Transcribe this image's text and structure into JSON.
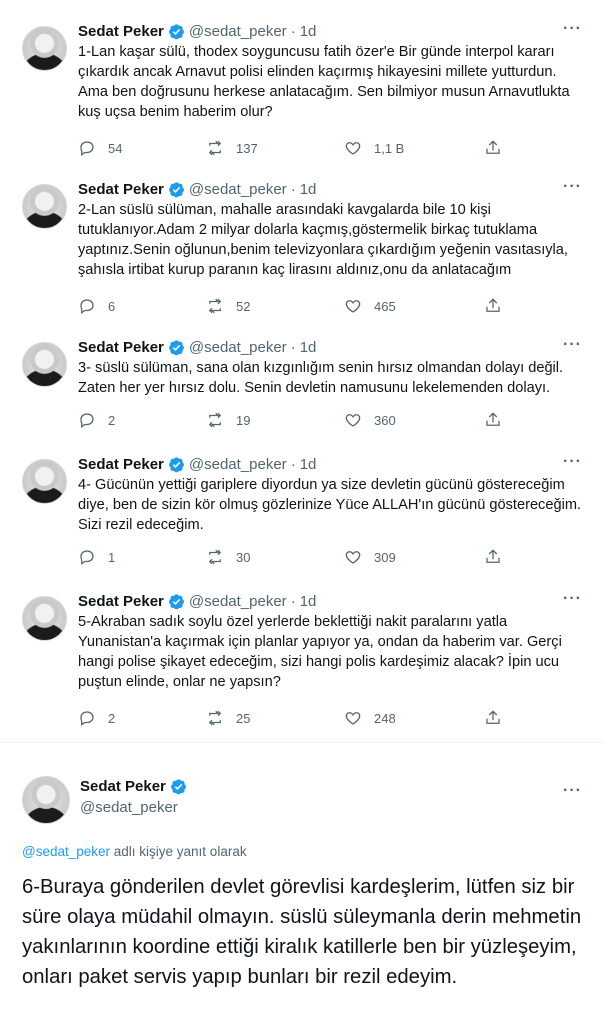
{
  "author": {
    "name": "Sedat Peker",
    "handle": "@sedat_peker",
    "time": "1d"
  },
  "colors": {
    "accent": "#1d9bf0",
    "muted": "#536471",
    "text": "#0f1419"
  },
  "tweets": [
    {
      "text": "1-Lan kaşar sülü, thodex soyguncusu fatih özer'e Bir günde interpol kararı çıkardık ancak Arnavut polisi elinden kaçırmış hikayesini millete yutturdun. Ama ben doğrusunu herkese anlatacağım. Sen bilmiyor musun Arnavutlukta kuş uçsa benim haberim olur?",
      "replies": "54",
      "retweets": "137",
      "likes": "1,1 B"
    },
    {
      "text": "2-Lan süslü sülüman, mahalle arasındaki kavgalarda bile 10 kişi tutuklanıyor.Adam 2 milyar dolarla kaçmış,göstermelik birkaç tutuklama yaptınız.Senin oğlunun,benim televizyonlara çıkardığım yeğenin vasıtasıyla, şahısla irtibat kurup paranın kaç lirasını aldınız,onu da anlatacağım",
      "replies": "6",
      "retweets": "52",
      "likes": "465"
    },
    {
      "text": "3- süslü sülüman, sana olan kızgınlığım senin hırsız olmandan dolayı değil. Zaten her yer hırsız dolu. Senin devletin namusunu lekelemenden dolayı.",
      "replies": "2",
      "retweets": "19",
      "likes": "360"
    },
    {
      "text": "4- Gücünün yettiği gariplere diyordun ya size devletin gücünü göstereceğim diye, ben de sizin kör olmuş gözlerinize Yüce ALLAH'ın gücünü göstereceğim. Sizi rezil edeceğim.",
      "replies": "1",
      "retweets": "30",
      "likes": "309"
    },
    {
      "text": "5-Akraban sadık soylu özel yerlerde beklettiği nakit paralarını yatla Yunanistan'a kaçırmak için planlar yapıyor ya, ondan da haberim var. Gerçi hangi polise şikayet edeceğim, sizi hangi polis kardeşimiz alacak? İpin ucu puştun elinde, onlar ne yapsın?",
      "replies": "2",
      "retweets": "25",
      "likes": "248"
    }
  ],
  "main_tweet": {
    "reply_prefix": "@sedat_peker",
    "reply_suffix": " adlı kişiye yanıt olarak",
    "text": "6-Buraya gönderilen devlet görevlisi kardeşlerim, lütfen siz bir süre olaya müdahil olmayın. süslü süleymanla derin mehmetin yakınlarının koordine ettiği kiralık katillerle ben bir yüzleşeyim, onları paket servis yapıp bunları bir rezil edeyim."
  },
  "more_label": "···"
}
